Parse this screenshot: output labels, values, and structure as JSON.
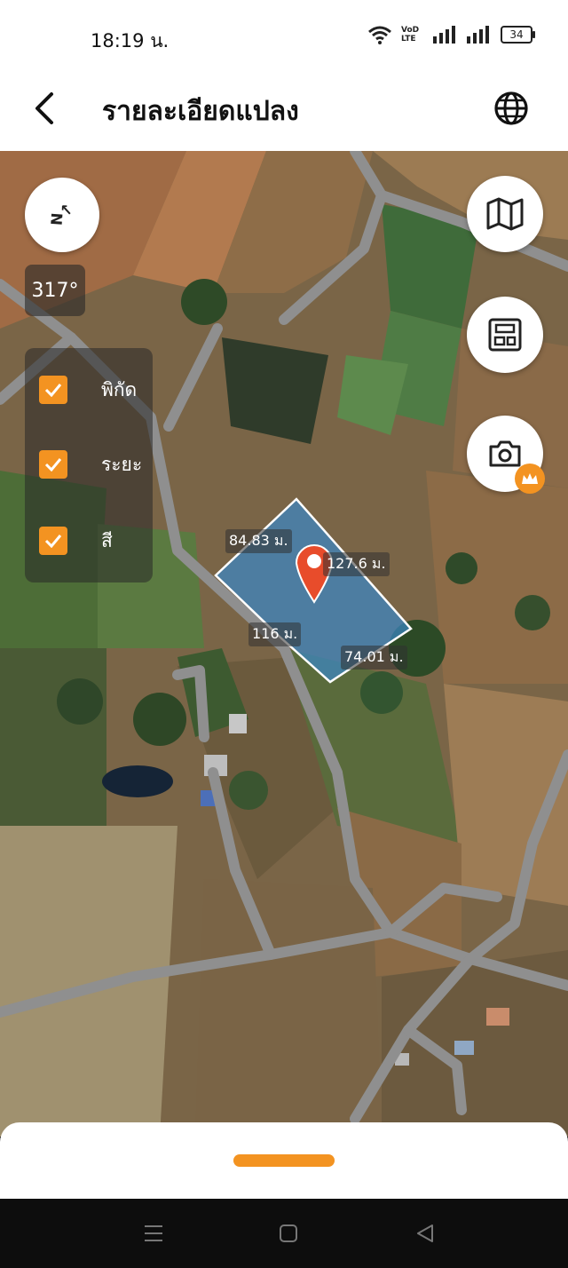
{
  "status": {
    "time": "18:19 น.",
    "network": "VoD LTE",
    "battery": "34"
  },
  "header": {
    "title": "รายละเอียดแปลง",
    "back_icon": "back-arrow-icon",
    "globe_icon": "globe-icon"
  },
  "map": {
    "compass_label": "N",
    "bearing": "317°",
    "layers": [
      {
        "label": "พิกัด",
        "checked": true
      },
      {
        "label": "ระยะ",
        "checked": true
      },
      {
        "label": "สี",
        "checked": true
      }
    ],
    "distances": {
      "side_nw": "84.83 ม.",
      "side_ne": "127.6 ม.",
      "side_sw": "116 ม.",
      "side_se": "74.01 ม."
    },
    "colors": {
      "accent": "#f39321",
      "parcel_fill": "#3b87c7",
      "parcel_stroke": "#ffffff",
      "pin": "#e84c2b"
    }
  },
  "fabs": [
    "map-icon",
    "calculator-icon",
    "camera-icon"
  ],
  "navbar": [
    "menu-icon",
    "home-icon",
    "back-icon"
  ]
}
